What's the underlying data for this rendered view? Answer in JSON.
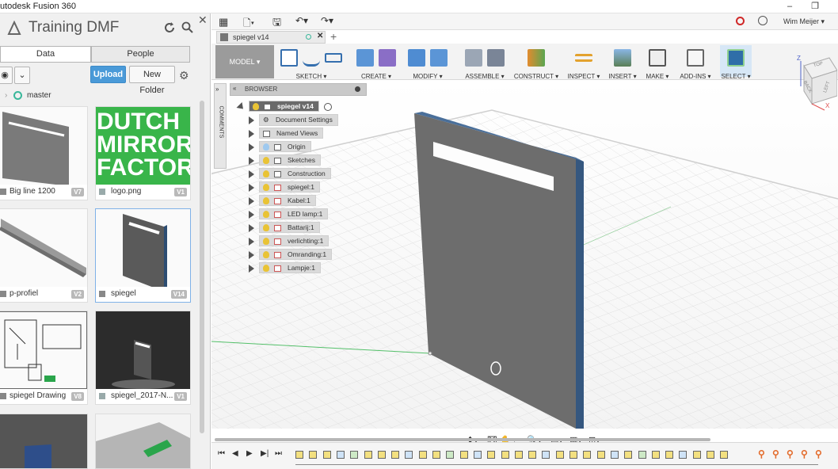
{
  "window": {
    "title": "utodesk Fusion 360",
    "min": "–",
    "restore": "❐"
  },
  "data_panel": {
    "project": "Training DMF",
    "tabs": [
      "Data",
      "People"
    ],
    "upload": "Upload",
    "new_folder": "New Folder",
    "branch": "master",
    "items": [
      {
        "name": "Big line 1200",
        "version": "V7"
      },
      {
        "name": "logo.png",
        "version": "V1"
      },
      {
        "name": "p-profiel",
        "version": "V2"
      },
      {
        "name": "spiegel",
        "version": "V14"
      },
      {
        "name": "spiegel Drawing",
        "version": "V8"
      },
      {
        "name": "spiegel_2017-N...",
        "version": "V1"
      }
    ],
    "logo_lines": [
      "DUTCH",
      "MIRROR",
      "FACTORY"
    ]
  },
  "user": {
    "name": "Wim Meijer ▾"
  },
  "document": {
    "tab": "spiegel v14"
  },
  "toolbar": {
    "mode": "MODEL ▾",
    "groups": [
      "SKETCH ▾",
      "CREATE ▾",
      "MODIFY ▾",
      "ASSEMBLE ▾",
      "CONSTRUCT ▾",
      "INSPECT ▾",
      "INSERT ▾",
      "MAKE ▾",
      "ADD-INS ▾",
      "SELECT ▾"
    ]
  },
  "browser": {
    "title": "BROWSER",
    "root": "spiegel v14",
    "nodes": [
      "Document Settings",
      "Named Views",
      "Origin",
      "Sketches",
      "Construction",
      "spiegel:1",
      "Kabel:1",
      "LED lamp:1",
      "Battarij:1",
      "verlichting:1",
      "Omranding:1",
      "Lampje:1"
    ]
  },
  "side": {
    "comments": "COMMENTS"
  },
  "viewcube": {
    "top": "TOP",
    "front": "BACK",
    "left": "LEFT",
    "z": "Z",
    "x": "X"
  }
}
